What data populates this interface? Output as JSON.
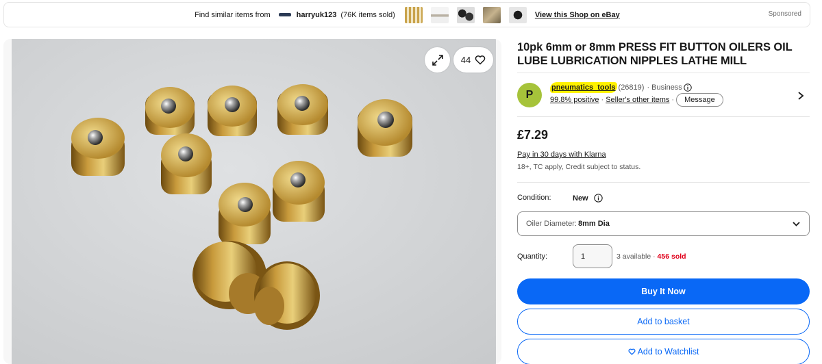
{
  "banner": {
    "find_text": "Find similar items from",
    "shop_name": "harryuk123",
    "shop_count": "(76K items sold)",
    "link_text": "View this Shop on eBay",
    "sponsored": "Sponsored"
  },
  "gallery": {
    "watch_count": "44",
    "image_alt": "Brass press fit button oilers on white surface"
  },
  "listing": {
    "title": "10pk 6mm or 8mm PRESS FIT BUTTON OILERS OIL LUBE LUBRICATION NIPPLES LATHE MILL"
  },
  "seller": {
    "avatar_letter": "P",
    "name": "pneumatics_tools",
    "feedback_count": "(26819)",
    "type": "· Business",
    "positive": "99.8% positive",
    "other_items": "Seller's other items",
    "message_label": "Message",
    "highlight_color": "#fff200"
  },
  "price": {
    "amount": "£7.29",
    "klarna": "Pay in 30 days with Klarna",
    "klarna_note": "18+, TC apply, Credit subject to status."
  },
  "condition": {
    "label": "Condition:",
    "value": "New"
  },
  "variant": {
    "label": "Oiler Diameter:",
    "value": "8mm Dia"
  },
  "quantity": {
    "label": "Quantity:",
    "value": "1",
    "available": "3 available",
    "sold": "456 sold"
  },
  "actions": {
    "buy_now": "Buy It Now",
    "add_to_basket": "Add to basket",
    "add_to_watchlist": "Add to Watchlist"
  },
  "colors": {
    "primary_blue": "#0968f6",
    "sold_red": "#e0001b",
    "avatar_green": "#a6c33a"
  }
}
